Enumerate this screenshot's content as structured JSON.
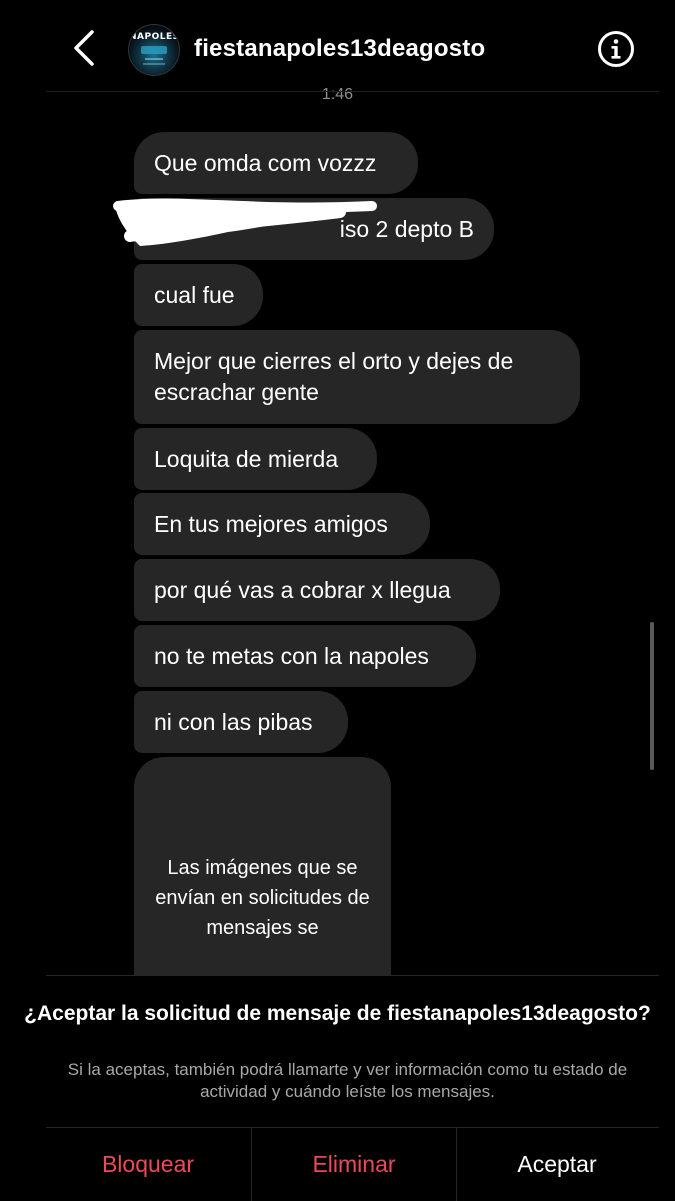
{
  "header": {
    "username": "fiestanapoles13deagosto",
    "avatar_text": "NAPOLES",
    "icons": {
      "back": "chevron-left-icon",
      "info": "info-icon"
    }
  },
  "chat": {
    "timestamp": "1:46",
    "messages": [
      "Que omda com vozzz",
      "iso 2 depto B",
      "cual fue",
      "Mejor que cierres el orto y dejes de escrachar gente",
      "Loquita de mierda",
      "En tus mejores amigos",
      "por qué vas a cobrar x llegua",
      "no te metas con la napoles",
      "ni con las pibas"
    ],
    "image_placeholder": "Las imágenes que se envían en solicitudes de mensajes se"
  },
  "request_panel": {
    "title": "¿Aceptar la solicitud de mensaje de fiestanapoles13deagosto?",
    "subtitle": "Si la aceptas, también podrá llamarte y ver información como tu estado de actividad y cuándo leíste los mensajes.",
    "block_label": "Bloquear",
    "delete_label": "Eliminar",
    "accept_label": "Aceptar"
  },
  "colors": {
    "background": "#000000",
    "bubble": "#262626",
    "danger": "#ed4956",
    "muted": "#a8a8a8"
  }
}
